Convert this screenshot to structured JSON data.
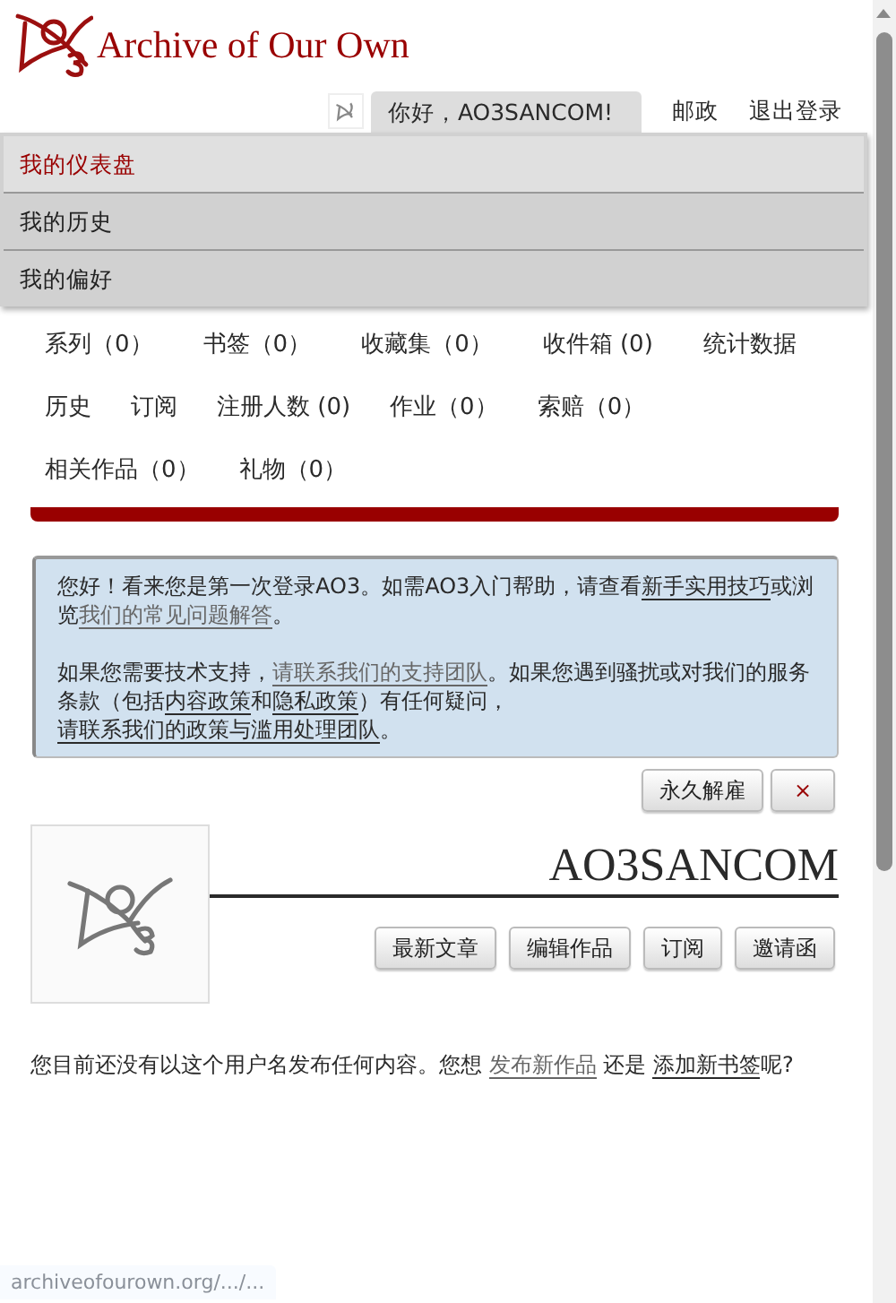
{
  "header": {
    "site_title": "Archive of Our Own"
  },
  "user_nav": {
    "greeting": "你好，AO3SANCOM!",
    "links": [
      "邮政",
      "退出登录"
    ]
  },
  "user_menu": [
    {
      "label": "我的仪表盘",
      "selected": true
    },
    {
      "label": "我的历史",
      "selected": false
    },
    {
      "label": "我的偏好",
      "selected": false
    }
  ],
  "dashboard_nav": [
    [
      "系列（0）",
      "书签（0）",
      "收藏集（0）",
      "收件箱 (0)",
      "统计数据"
    ],
    [
      "历史",
      "订阅",
      "注册人数 (0)",
      "作业（0）",
      "索赔（0）"
    ],
    [
      "相关作品（0）",
      "礼物（0）"
    ]
  ],
  "notice": {
    "paragraphs": [
      [
        {
          "kind": "text",
          "text": "您好！看来您是第一次登录AO3。如需AO3入门帮助，请查看"
        },
        {
          "kind": "link",
          "text": "新手实用技巧",
          "visited": false
        },
        {
          "kind": "text",
          "text": "或浏览"
        },
        {
          "kind": "link",
          "text": "我们的常见问题解答",
          "visited": true
        },
        {
          "kind": "text",
          "text": "。"
        }
      ],
      [
        {
          "kind": "text",
          "text": "如果您需要技术支持，"
        },
        {
          "kind": "link",
          "text": "请联系我们的支持团队",
          "visited": true
        },
        {
          "kind": "text",
          "text": "。如果您遇到骚扰或对我们的服务条款（包括"
        },
        {
          "kind": "link",
          "text": "内容政策",
          "visited": false
        },
        {
          "kind": "text",
          "text": "和"
        },
        {
          "kind": "link",
          "text": "隐私政策",
          "visited": false
        },
        {
          "kind": "text",
          "text": "）有任何疑问，"
        },
        {
          "kind": "link",
          "text": "请联系我们的政策与滥用处理团队",
          "visited": false
        },
        {
          "kind": "text",
          "text": "。"
        }
      ]
    ],
    "buttons": [
      "永久解雇",
      "×"
    ]
  },
  "profile": {
    "username": "AO3SANCOM",
    "buttons": [
      "最新文章",
      "编辑作品",
      "订阅",
      "邀请函"
    ]
  },
  "empty_message": [
    {
      "kind": "text",
      "text": "您目前还没有以这个用户名发布任何内容。您想 "
    },
    {
      "kind": "link",
      "text": "发布新作品",
      "visited": true
    },
    {
      "kind": "text",
      "text": " 还是 "
    },
    {
      "kind": "link",
      "text": "添加新书签",
      "visited": false
    },
    {
      "kind": "text",
      "text": "呢?"
    }
  ],
  "status_bar": {
    "url": "archiveofourown.org/.../..."
  }
}
